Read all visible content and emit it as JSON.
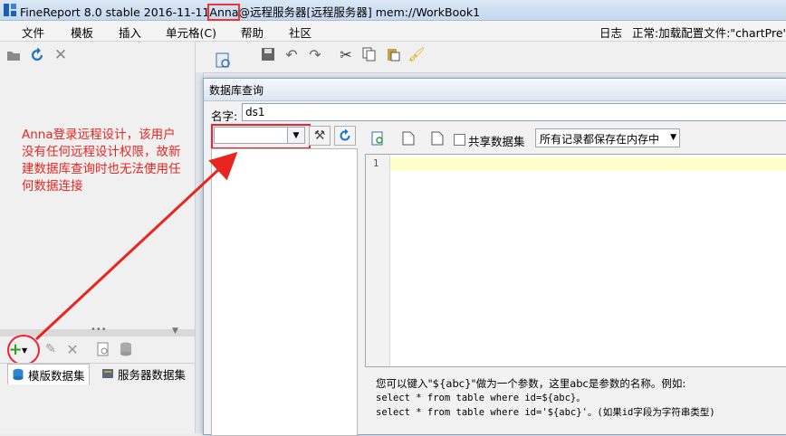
{
  "window": {
    "title_prefix": "FineReport 8.0 stable 2016-11-11",
    "user": "Anna",
    "title_suffix": "@远程服务器[远程服务器]    mem://WorkBook1"
  },
  "menu": {
    "items": [
      "文件",
      "模板",
      "插入",
      "单元格(C)",
      "帮助",
      "社区"
    ],
    "log_label": "日志",
    "status_text": "正常:加载配置文件:\"chartPre\""
  },
  "annotation": {
    "text": "Anna登录远程设计，该用户没有任何远程设计权限，故新建数据库查询时也无法使用任何数据连接"
  },
  "dataset_tabs": {
    "template_label": "模版数据集",
    "server_label": "服务器数据集"
  },
  "dialog": {
    "title": "数据库查询",
    "name_label": "名字:",
    "name_value": "ds1",
    "connection_value": "",
    "share_label": "共享数据集",
    "share_checked": false,
    "storage_option": "所有记录都保存在内存中",
    "line_number": "1",
    "hint_line1": "您可以键入\"${abc}\"做为一个参数，这里abc是参数的名称。例如:",
    "hint_line2": "select * from table where id=${abc}。",
    "hint_line3": "select * from table where id='${abc}'。(如果id字段为字符串类型)"
  },
  "colors": {
    "annotation_red": "#e8261f",
    "editor_highlight": "#ffffcc",
    "refresh_blue": "#1a73c9"
  }
}
